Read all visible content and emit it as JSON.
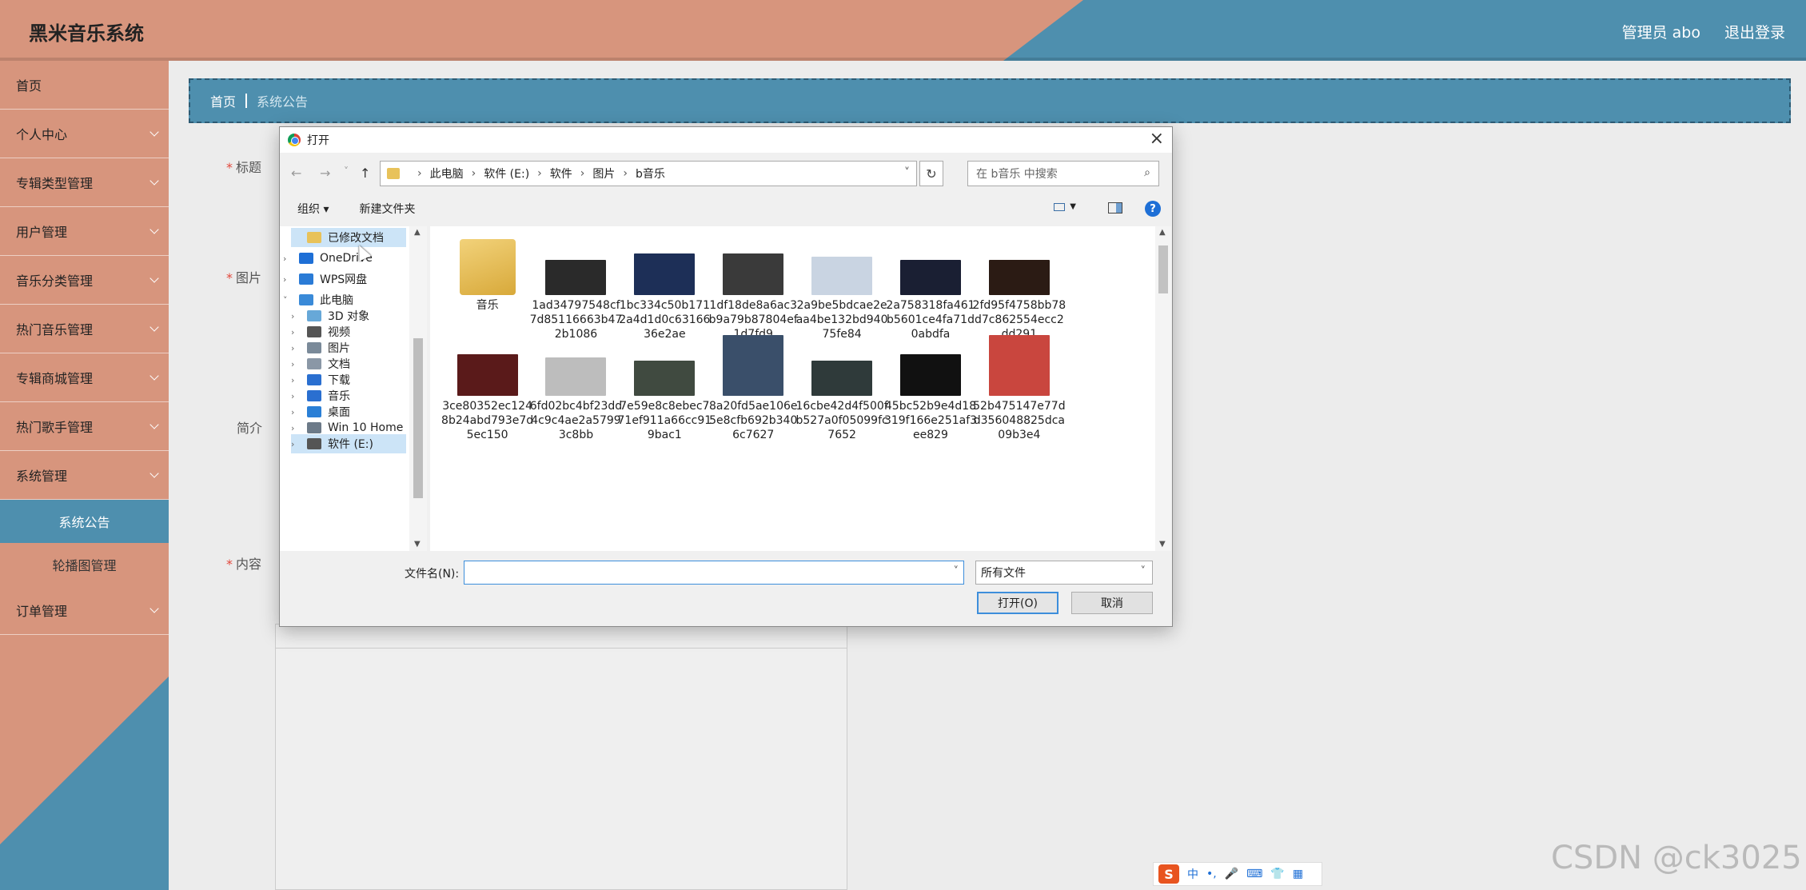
{
  "header": {
    "app_title": "黑米音乐系统",
    "admin": "管理员 abo",
    "logout": "退出登录"
  },
  "sidebar": {
    "items": [
      {
        "label": "首页",
        "has_children": false
      },
      {
        "label": "个人中心",
        "has_children": true
      },
      {
        "label": "专辑类型管理",
        "has_children": true
      },
      {
        "label": "用户管理",
        "has_children": true
      },
      {
        "label": "音乐分类管理",
        "has_children": true
      },
      {
        "label": "热门音乐管理",
        "has_children": true
      },
      {
        "label": "专辑商城管理",
        "has_children": true
      },
      {
        "label": "热门歌手管理",
        "has_children": true
      },
      {
        "label": "系统管理",
        "has_children": true
      }
    ],
    "sub_items": [
      {
        "label": "系统公告",
        "active": true
      },
      {
        "label": "轮播图管理",
        "active": false
      }
    ],
    "last_item": {
      "label": "订单管理",
      "has_children": true
    }
  },
  "breadcrumb": {
    "home": "首页",
    "current": "系统公告"
  },
  "form": {
    "title_label": "标题",
    "image_label": "图片",
    "intro_label": "简介",
    "content_label": "内容",
    "required_mark": "*"
  },
  "dialog": {
    "title": "打开",
    "close": "×",
    "nav": {
      "back": "←",
      "forward": "→",
      "recent": "˅",
      "up": "↑"
    },
    "address": [
      "此电脑",
      "软件 (E:)",
      "软件",
      "图片",
      "b音乐"
    ],
    "refresh": "↻",
    "search_placeholder": "在 b音乐 中搜索",
    "organize": "组织 ▾",
    "new_folder": "新建文件夹",
    "help": "?",
    "tree": [
      {
        "label": "已修改文档",
        "expander": "",
        "level": 1,
        "selected": true,
        "icon_color": "#e8c25a"
      },
      {
        "label": "OneDrive",
        "expander": "›",
        "level": 0,
        "selected": false,
        "icon_color": "#1e6fd6"
      },
      {
        "label": "WPS网盘",
        "expander": "›",
        "level": 0,
        "selected": false,
        "icon_color": "#2a7bd6"
      },
      {
        "label": "此电脑",
        "expander": "˅",
        "level": 0,
        "selected": false,
        "icon_color": "#3a8ad8"
      },
      {
        "label": "3D 对象",
        "expander": "›",
        "level": 1,
        "selected": false,
        "icon_color": "#67a8d8"
      },
      {
        "label": "视频",
        "expander": "›",
        "level": 1,
        "selected": false,
        "icon_color": "#555555"
      },
      {
        "label": "图片",
        "expander": "›",
        "level": 1,
        "selected": false,
        "icon_color": "#7a8a99"
      },
      {
        "label": "文档",
        "expander": "›",
        "level": 1,
        "selected": false,
        "icon_color": "#8a97a6"
      },
      {
        "label": "下载",
        "expander": "›",
        "level": 1,
        "selected": false,
        "icon_color": "#2a6fd0"
      },
      {
        "label": "音乐",
        "expander": "›",
        "level": 1,
        "selected": false,
        "icon_color": "#2a6fd0"
      },
      {
        "label": "桌面",
        "expander": "›",
        "level": 1,
        "selected": false,
        "icon_color": "#2a7fd6"
      },
      {
        "label": "Win 10 Home",
        "expander": "›",
        "level": 1,
        "selected": false,
        "icon_color": "#6c7a88"
      },
      {
        "label": "软件 (E:)",
        "expander": "›",
        "level": 1,
        "selected": true,
        "icon_color": "#555555"
      }
    ],
    "files": [
      {
        "name": "音乐",
        "kind": "folder",
        "color": "#e8c25a"
      },
      {
        "name": "1ad34797548cf7d85116663b472b1086",
        "kind": "image",
        "color": "#2a2a2a"
      },
      {
        "name": "1bc334c50b1712a4d1d0c6316636e2ae",
        "kind": "image",
        "color": "#1d2f57"
      },
      {
        "name": "1df18de8a6ac3b9a79b87804ef1d7fd9",
        "kind": "image",
        "color": "#3a3a3a"
      },
      {
        "name": "2a9be5bdcae2eaa4be132bd94075fe84",
        "kind": "image",
        "color": "#c9d4e2"
      },
      {
        "name": "2a758318fa461b5601ce4fa71d0abdfa",
        "kind": "image",
        "color": "#1a1f33"
      },
      {
        "name": "2fd95f4758bb78d7c862554ecc2dd291",
        "kind": "image",
        "color": "#2b1b14"
      },
      {
        "name": "3ce80352ec1248b24abd793e7d5ec150",
        "kind": "image",
        "color": "#5a1a1a"
      },
      {
        "name": "6fd02bc4bf23dd4c9c4ae2a57993c8bb",
        "kind": "image",
        "color": "#bdbdbd"
      },
      {
        "name": "7e59e8c8ebec771ef911a66cc919bac1",
        "kind": "image",
        "color": "#404a40"
      },
      {
        "name": "8a20fd5ae106e5e8cfb692b3406c7627",
        "kind": "image",
        "color": "#3a4f6a"
      },
      {
        "name": "16cbe42d4f500fb527a0f05099fc7652",
        "kind": "image",
        "color": "#2f3a3a"
      },
      {
        "name": "45bc52b9e4d18319f166e251af3ee829",
        "kind": "image",
        "color": "#111111"
      },
      {
        "name": "52b475147e77dd356048825dca09b3e4",
        "kind": "image",
        "color": "#c9463e"
      }
    ],
    "filename_label": "文件名(N):",
    "filename_value": "",
    "filetype": "所有文件",
    "open_btn": "打开(O)",
    "cancel_btn": "取消"
  },
  "ime": {
    "logo": "S",
    "lang": "中",
    "punct": "•,",
    "mic": "🎤",
    "kb": "⌨",
    "skin": "👕",
    "tools": "▦"
  },
  "watermark": "CSDN @ck3025"
}
